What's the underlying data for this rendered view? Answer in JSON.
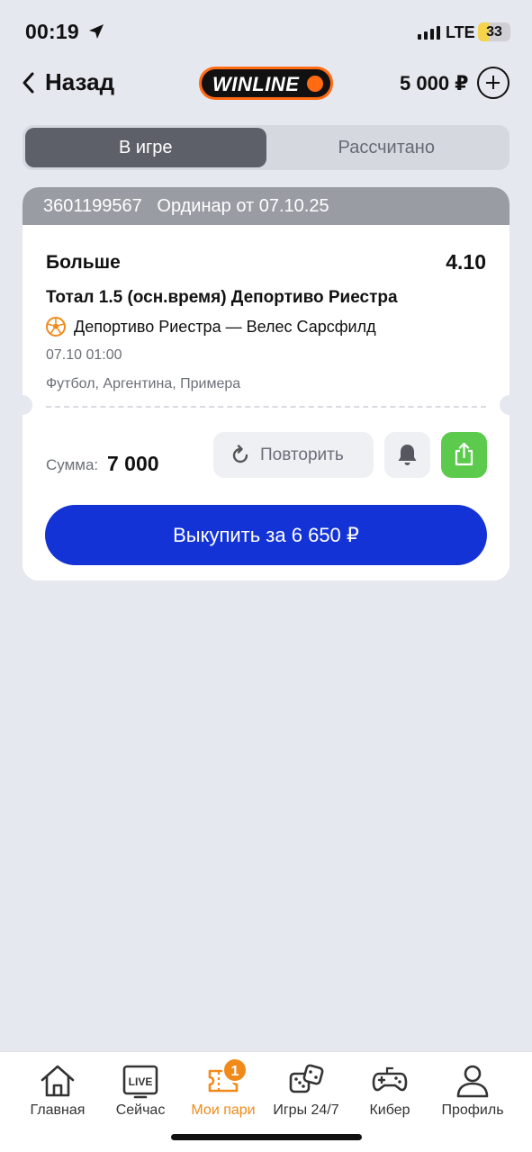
{
  "status_bar": {
    "time": "00:19",
    "network": "LTE",
    "battery": "33",
    "battery_level_percent": 33,
    "accent_color": "#f5d34a"
  },
  "header": {
    "back_label": "Назад",
    "logo_text": "WINLINE",
    "balance": "5 000 ₽",
    "brand_color": "#ff6a13"
  },
  "tabs": [
    {
      "label": "В игре",
      "active": true
    },
    {
      "label": "Рассчитано",
      "active": false
    }
  ],
  "bet": {
    "header": "3601199567   Ординар от 07.10.25",
    "outcome": "Больше",
    "odds": "4.10",
    "market": "Тотал 1.5 (осн.время) Депортиво Риестра",
    "event": "Депортиво Риестра — Велес Сарсфилд",
    "datetime": "07.10 01:00",
    "league": "Футбол, Аргентина, Примера",
    "sum_label": "Сумма:",
    "sum_value": "7 000",
    "repeat_label": "Повторить",
    "cashout_label": "Выкупить за 6 650 ₽",
    "cashout_color": "#1433d6",
    "share_color": "#5ccb4d"
  },
  "bottom_nav": {
    "items": [
      {
        "label": "Главная",
        "icon": "home-icon",
        "active": false
      },
      {
        "label": "Сейчас",
        "icon": "live-icon",
        "active": false,
        "icon_text": "LIVE"
      },
      {
        "label": "Мои пари",
        "icon": "ticket-icon",
        "active": true,
        "badge": "1"
      },
      {
        "label": "Игры 24/7",
        "icon": "dice-icon",
        "active": false
      },
      {
        "label": "Кибер",
        "icon": "gamepad-icon",
        "active": false
      },
      {
        "label": "Профиль",
        "icon": "profile-icon",
        "active": false
      }
    ],
    "active_color": "#f28a1a"
  }
}
